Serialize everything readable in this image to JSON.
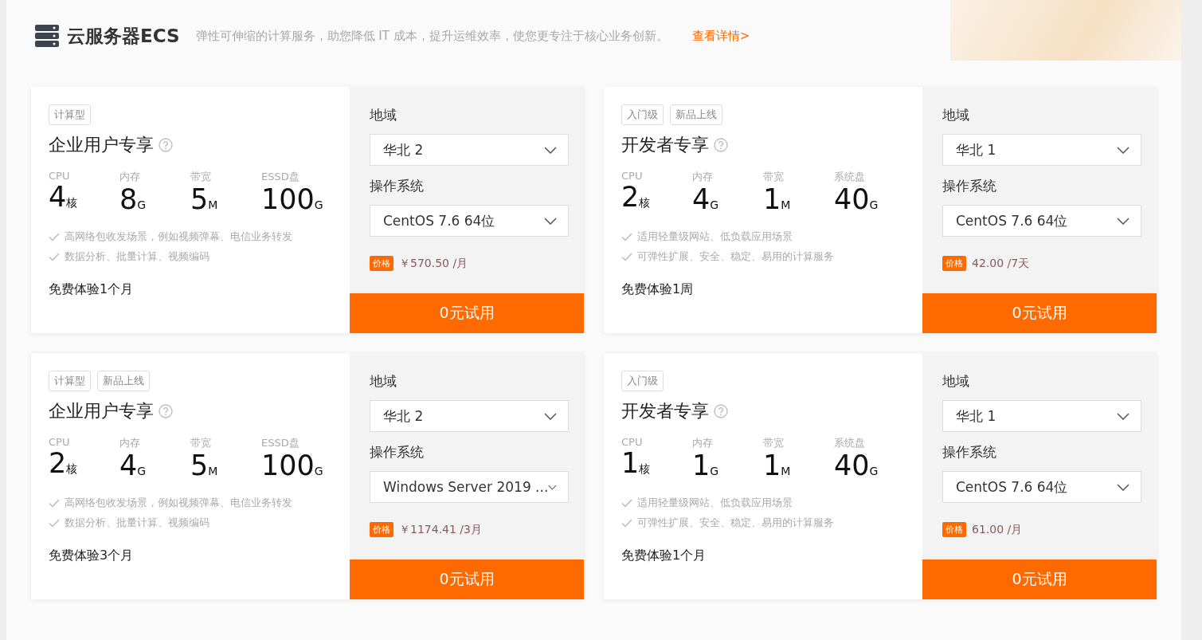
{
  "header": {
    "title": "云服务器ECS",
    "description": "弹性可伸缩的计算服务，助您降低 IT 成本，提升运维效率，使您更专注于核心业务创新。",
    "link": "查看详情>"
  },
  "cards": [
    {
      "tags": [
        "计算型"
      ],
      "name": "企业用户专享",
      "specs": [
        {
          "label": "CPU",
          "value": "4",
          "unit": "核"
        },
        {
          "label": "内存",
          "value": "8",
          "unit": "G"
        },
        {
          "label": "带宽",
          "value": "5",
          "unit": "M"
        },
        {
          "label": "ESSD盘",
          "value": "100",
          "unit": "G"
        }
      ],
      "features": [
        "高网络包收发场景，例如视频弹幕、电信业务转发",
        "数据分析、批量计算、视频编码"
      ],
      "trial": "免费体验1个月",
      "region_label": "地域",
      "region": "华北 2",
      "os_label": "操作系统",
      "os": "CentOS 7.6 64位",
      "price_tag": "价格",
      "price": "￥570.50 /月",
      "button": "0元试用"
    },
    {
      "tags": [
        "入门级",
        "新品上线"
      ],
      "name": "开发者专享",
      "specs": [
        {
          "label": "CPU",
          "value": "2",
          "unit": "核"
        },
        {
          "label": "内存",
          "value": "4",
          "unit": "G"
        },
        {
          "label": "带宽",
          "value": "1",
          "unit": "M"
        },
        {
          "label": "系统盘",
          "value": "40",
          "unit": "G"
        }
      ],
      "features": [
        "适用轻量级网站、低负载应用场景",
        "可弹性扩展、安全、稳定、易用的计算服务"
      ],
      "trial": "免费体验1周",
      "region_label": "地域",
      "region": "华北 1",
      "os_label": "操作系统",
      "os": "CentOS 7.6 64位",
      "price_tag": "价格",
      "price": "42.00 /7天",
      "button": "0元试用"
    },
    {
      "tags": [
        "计算型",
        "新品上线"
      ],
      "name": "企业用户专享",
      "specs": [
        {
          "label": "CPU",
          "value": "2",
          "unit": "核"
        },
        {
          "label": "内存",
          "value": "4",
          "unit": "G"
        },
        {
          "label": "带宽",
          "value": "5",
          "unit": "M"
        },
        {
          "label": "ESSD盘",
          "value": "100",
          "unit": "G"
        }
      ],
      "features": [
        "高网络包收发场景，例如视频弹幕、电信业务转发",
        "数据分析、批量计算、视频编码"
      ],
      "trial": "免费体验3个月",
      "region_label": "地域",
      "region": "华北 2",
      "os_label": "操作系统",
      "os": "Windows Server 2019 ...",
      "price_tag": "价格",
      "price": "￥1174.41 /3月",
      "button": "0元试用"
    },
    {
      "tags": [
        "入门级"
      ],
      "name": "开发者专享",
      "specs": [
        {
          "label": "CPU",
          "value": "1",
          "unit": "核"
        },
        {
          "label": "内存",
          "value": "1",
          "unit": "G"
        },
        {
          "label": "带宽",
          "value": "1",
          "unit": "M"
        },
        {
          "label": "系统盘",
          "value": "40",
          "unit": "G"
        }
      ],
      "features": [
        "适用轻量级网站、低负载应用场景",
        "可弹性扩展、安全、稳定、易用的计算服务"
      ],
      "trial": "免费体验1个月",
      "region_label": "地域",
      "region": "华北 1",
      "os_label": "操作系统",
      "os": "CentOS 7.6 64位",
      "price_tag": "价格",
      "price": "61.00 /月",
      "button": "0元试用"
    }
  ]
}
